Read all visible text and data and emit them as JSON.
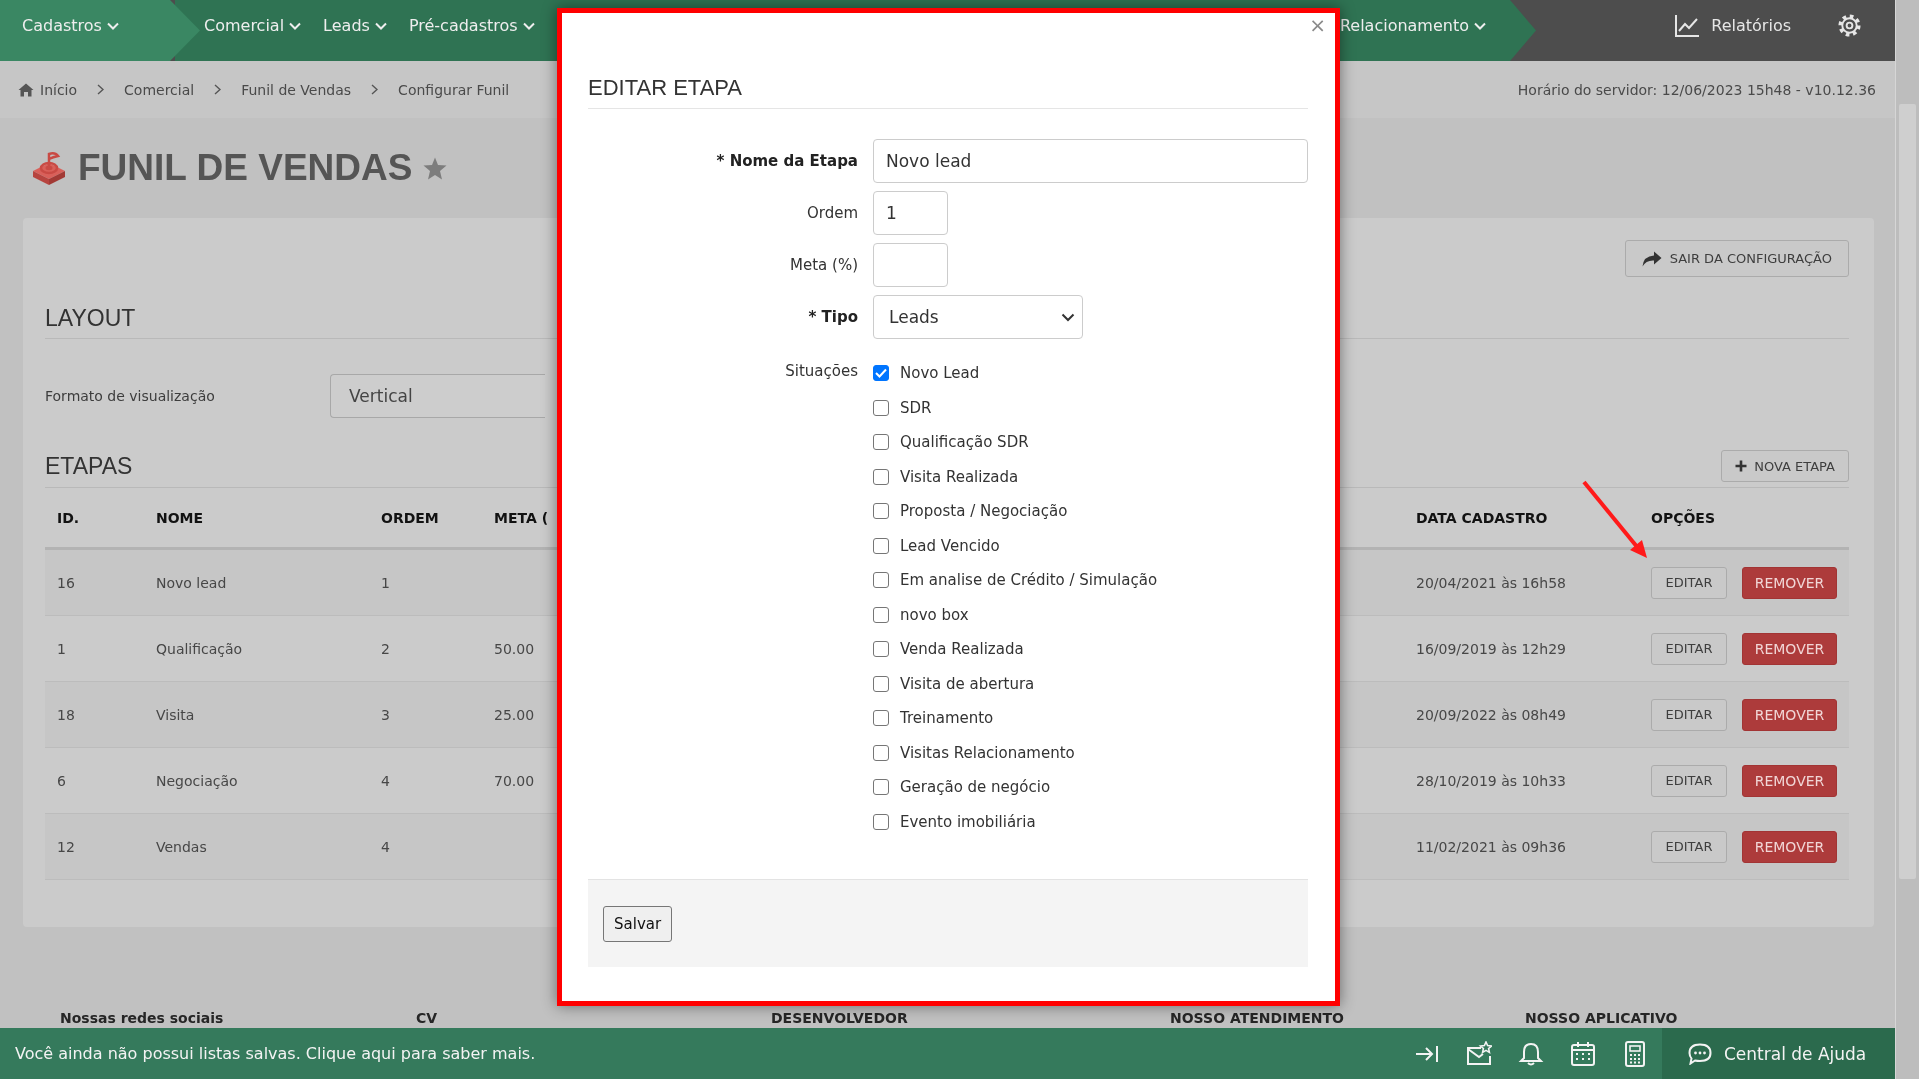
{
  "nav": {
    "primary": "Cadastros",
    "menus": [
      "Comercial",
      "Leads",
      "Pré-cadastros"
    ],
    "menus_right": [
      "Relacionamento"
    ],
    "reports": "Relatórios"
  },
  "breadcrumb": [
    "Início",
    "Comercial",
    "Funil de Vendas",
    "Configurar Funil"
  ],
  "server_time": "Horário do servidor: 12/06/2023 15h48 - v10.12.36",
  "page_title": "FUNIL DE VENDAS",
  "exit_button": "SAIR DA CONFIGURAÇÃO",
  "layout": {
    "heading": "LAYOUT",
    "label": "Formato de visualização",
    "value": "Vertical"
  },
  "stages": {
    "heading": "ETAPAS",
    "new_button": "NOVA ETAPA",
    "columns": [
      "ID.",
      "NOME",
      "ORDEM",
      "META (",
      "DATA CADASTRO",
      "OPÇÕES"
    ],
    "rows": [
      {
        "id": "16",
        "name": "Novo lead",
        "order": "1",
        "created": "20/04/2021 às 16h58",
        "edit": "EDITAR",
        "remove": "REMOVER"
      },
      {
        "id": "1",
        "name": "Qualificação",
        "order": "2",
        "meta": "50.00",
        "created": "16/09/2019 às 12h29",
        "edit": "EDITAR",
        "remove": "REMOVER"
      },
      {
        "id": "18",
        "name": "Visita",
        "order": "3",
        "meta": "25.00",
        "created": "20/09/2022 às 08h49",
        "edit": "EDITAR",
        "remove": "REMOVER"
      },
      {
        "id": "6",
        "name": "Negociação",
        "order": "4",
        "meta": "70.00",
        "created": "28/10/2019 às 10h33",
        "edit": "EDITAR",
        "remove": "REMOVER"
      },
      {
        "id": "12",
        "name": "Vendas",
        "order": "4",
        "created": "11/02/2021 às 09h36",
        "edit": "EDITAR",
        "remove": "REMOVER"
      }
    ]
  },
  "modal": {
    "close": "×",
    "title": "EDITAR ETAPA",
    "fields": [
      {
        "label": "* Nome da Etapa",
        "required": true,
        "kind": "text",
        "value": "Novo lead"
      },
      {
        "label": "Ordem",
        "required": false,
        "kind": "short",
        "value": "1"
      },
      {
        "label": "Meta (%)",
        "required": false,
        "kind": "short"
      },
      {
        "label": "* Tipo",
        "required": true,
        "kind": "select",
        "value": "Leads"
      }
    ],
    "situations_label": "Situações",
    "situations": [
      {
        "label": "Novo Lead",
        "checked": true
      },
      {
        "label": "SDR",
        "checked": false
      },
      {
        "label": "Qualificação SDR",
        "checked": false
      },
      {
        "label": "Visita Realizada",
        "checked": false
      },
      {
        "label": "Proposta / Negociação",
        "checked": false
      },
      {
        "label": "Lead Vencido",
        "checked": false
      },
      {
        "label": "Em analise de Crédito / Simulação",
        "checked": false
      },
      {
        "label": "novo box",
        "checked": false
      },
      {
        "label": "Venda Realizada",
        "checked": false
      },
      {
        "label": "Visita de abertura",
        "checked": false
      },
      {
        "label": "Treinamento",
        "checked": false
      },
      {
        "label": "Visitas Relacionamento",
        "checked": false
      },
      {
        "label": "Geração de negócio",
        "checked": false
      },
      {
        "label": "Evento imobiliária",
        "checked": false
      }
    ],
    "save": "Salvar"
  },
  "footer_headings": [
    "Nossas redes sociais",
    "CV",
    "DESENVOLVEDOR",
    "NOSSO ATENDIMENTO",
    "NOSSO APLICATIVO"
  ],
  "status_bar": {
    "message": "Você ainda não possui listas salvas. Clique aqui para saber mais.",
    "help": "Central de Ajuda"
  }
}
